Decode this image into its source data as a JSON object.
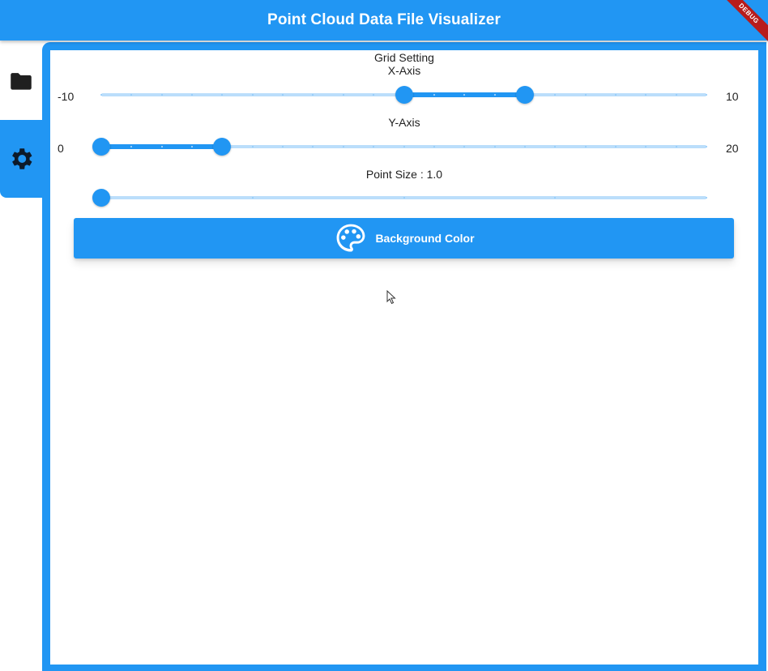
{
  "app": {
    "title": "Point Cloud Data File Visualizer",
    "debug_banner": "DEBUG",
    "primary_color": "#2196F3"
  },
  "sidebar": {
    "tabs": [
      {
        "icon": "folder-icon",
        "selected": false
      },
      {
        "icon": "settings-gear-icon",
        "selected": true
      }
    ]
  },
  "settings": {
    "heading": "Grid Setting",
    "x_axis": {
      "label": "X-Axis",
      "min_label": "-10",
      "max_label": "10",
      "min": -10,
      "max": 10,
      "start": 0,
      "end": 4,
      "divisions": 20
    },
    "y_axis": {
      "label": "Y-Axis",
      "min_label": "0",
      "max_label": "20",
      "min": 0,
      "max": 20,
      "start": 0,
      "end": 4,
      "divisions": 20
    },
    "point_size": {
      "label": "Point Size : 1.0",
      "value": 1.0,
      "min": 1.0,
      "max": 5.0,
      "divisions": 4
    },
    "background_button": {
      "label": "Background Color",
      "icon": "palette-icon"
    }
  }
}
